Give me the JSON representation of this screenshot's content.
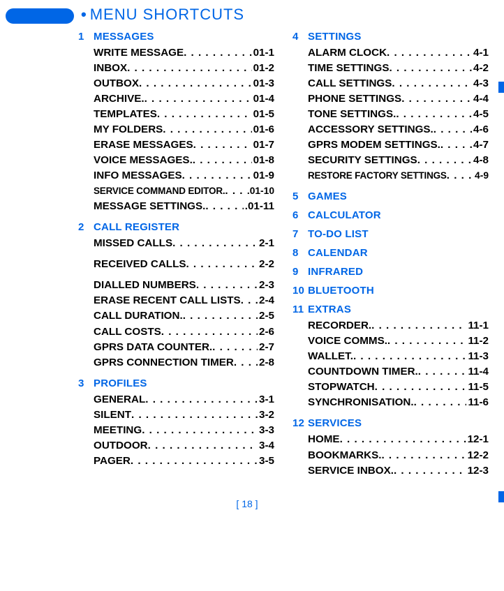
{
  "title": "MENU SHORTCUTS",
  "page_number_text": "[ 18 ]",
  "sections": [
    {
      "number": "1",
      "name": "MESSAGES",
      "items": [
        {
          "label": "WRITE MESSAGE",
          "code": "01-1"
        },
        {
          "label": "INBOX",
          "code": "01-2"
        },
        {
          "label": "OUTBOX",
          "code": "01-3"
        },
        {
          "label": "ARCHIVE.",
          "code": "01-4"
        },
        {
          "label": "TEMPLATES",
          "code": "01-5"
        },
        {
          "label": "MY FOLDERS",
          "code": "01-6"
        },
        {
          "label": "ERASE MESSAGES",
          "code": "01-7"
        },
        {
          "label": "VOICE MESSAGES.",
          "code": "01-8"
        },
        {
          "label": "INFO MESSAGES",
          "code": "01-9"
        },
        {
          "label": "SERVICE COMMAND EDITOR.",
          "code": ".01-10",
          "small": true
        },
        {
          "label": "MESSAGE SETTINGS.",
          "code": ".01-11"
        }
      ]
    },
    {
      "number": "2",
      "name": "CALL REGISTER",
      "items": [
        {
          "label": "MISSED CALLS",
          "code": "2-1"
        },
        {
          "label": "RECEIVED CALLS",
          "code": "2-2",
          "gap": true
        },
        {
          "label": "DIALLED NUMBERS",
          "code": "2-3",
          "gap": true
        },
        {
          "label": "ERASE RECENT CALL LISTS",
          "code": "2-4"
        },
        {
          "label": "CALL DURATION.",
          "code": "2-5"
        },
        {
          "label": "CALL COSTS",
          "code": "2-6"
        },
        {
          "label": "GPRS DATA COUNTER.",
          "code": "2-7"
        },
        {
          "label": "GPRS CONNECTION TIMER",
          "code": "2-8"
        }
      ]
    },
    {
      "number": "3",
      "name": "PROFILES",
      "items": [
        {
          "label": "GENERAL",
          "code": "3-1"
        },
        {
          "label": "SILENT",
          "code": "3-2"
        },
        {
          "label": "MEETING",
          "code": "3-3"
        },
        {
          "label": "OUTDOOR",
          "code": "3-4"
        },
        {
          "label": "PAGER",
          "code": "3-5"
        }
      ]
    },
    {
      "number": "4",
      "name": "SETTINGS",
      "items": [
        {
          "label": "ALARM CLOCK",
          "code": "4-1"
        },
        {
          "label": "TIME SETTINGS",
          "code": "4-2"
        },
        {
          "label": "CALL SETTINGS",
          "code": "4-3"
        },
        {
          "label": "PHONE SETTINGS",
          "code": "4-4"
        },
        {
          "label": "TONE SETTINGS.",
          "code": "4-5"
        },
        {
          "label": "ACCESSORY SETTINGS.",
          "code": "4-6"
        },
        {
          "label": "GPRS MODEM SETTINGS.",
          "code": "4-7"
        },
        {
          "label": "SECURITY SETTINGS",
          "code": "4-8"
        },
        {
          "label": "RESTORE FACTORY SETTINGS",
          "code": "4-9",
          "small": true
        }
      ]
    },
    {
      "number": "5",
      "name": "GAMES",
      "items": []
    },
    {
      "number": "6",
      "name": "CALCULATOR",
      "items": []
    },
    {
      "number": "7",
      "name": "TO-DO LIST",
      "items": []
    },
    {
      "number": "8",
      "name": "CALENDAR",
      "items": []
    },
    {
      "number": "9",
      "name": "INFRARED",
      "items": []
    },
    {
      "number": "10",
      "name": "BLUETOOTH",
      "items": []
    },
    {
      "number": "11",
      "name": "EXTRAS",
      "items": [
        {
          "label": "RECORDER.",
          "code": "11-1"
        },
        {
          "label": "VOICE COMMS.",
          "code": "11-2"
        },
        {
          "label": "WALLET.",
          "code": "11-3"
        },
        {
          "label": "COUNTDOWN TIMER.",
          "code": "11-4"
        },
        {
          "label": "STOPWATCH",
          "code": "11-5"
        },
        {
          "label": "SYNCHRONISATION.",
          "code": "11-6"
        }
      ]
    },
    {
      "number": "12",
      "name": "SERVICES",
      "items": [
        {
          "label": "HOME",
          "code": "12-1"
        },
        {
          "label": "BOOKMARKS.",
          "code": "12-2"
        },
        {
          "label": "SERVICE INBOX.",
          "code": "12-3"
        }
      ]
    }
  ],
  "left_sections": [
    "1",
    "2",
    "3"
  ],
  "right_sections": [
    "4",
    "5",
    "6",
    "7",
    "8",
    "9",
    "10",
    "11",
    "12"
  ]
}
